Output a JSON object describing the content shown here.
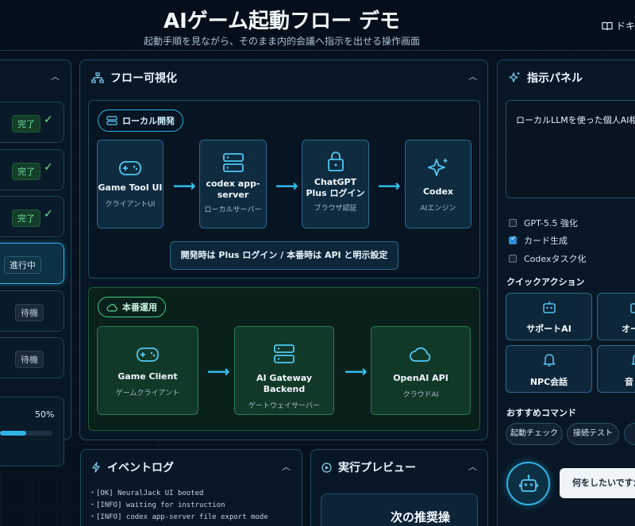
{
  "header": {
    "title": "AIゲーム起動フロー デモ",
    "subtitle": "起動手順を見ながら、そのまま内的会議へ指示を出せる操作画面",
    "doc_link": "ドキュ"
  },
  "steps": {
    "items": [
      {
        "status": "完了",
        "state": "done"
      },
      {
        "status": "完了",
        "state": "done"
      },
      {
        "status": "完了",
        "state": "done"
      },
      {
        "status": "進行中",
        "state": "active"
      },
      {
        "status": "待機",
        "state": "waiting"
      },
      {
        "status": "待機",
        "state": "waiting"
      }
    ],
    "progress_text": "50%",
    "progress_value": 0.5
  },
  "flow": {
    "title": "フロー可視化",
    "local": {
      "label": "ローカル開発",
      "nodes": [
        {
          "title": "Game Tool UI",
          "sub": "クライアントUI",
          "icon": "gamepad-icon"
        },
        {
          "title": "codex app-server",
          "sub": "ローカルサーバー",
          "icon": "server-icon"
        },
        {
          "title": "ChatGPT Plus ログイン",
          "sub": "ブラウザ認証",
          "icon": "lock-icon"
        },
        {
          "title": "Codex",
          "sub": "AIエンジン",
          "icon": "sparkle-icon"
        }
      ],
      "note": "開発時は Plus ログイン / 本番時は API と明示設定"
    },
    "production": {
      "label": "本番運用",
      "nodes": [
        {
          "title": "Game Client",
          "sub": "ゲームクライアント",
          "icon": "gamepad-icon"
        },
        {
          "title": "AI Gateway Backend",
          "sub": "ゲートウェイサーバー",
          "icon": "server-icon"
        },
        {
          "title": "OpenAI API",
          "sub": "クラウドAI",
          "icon": "cloud-icon"
        }
      ]
    }
  },
  "event_log": {
    "title": "イベントログ",
    "lines": [
      "・[OK] NeuralJack UI booted",
      "・[INFO] waiting for instruction",
      "・[INFO] codex app-server file export mode"
    ]
  },
  "preview": {
    "title": "実行プレビュー",
    "heading": "次の推奨操"
  },
  "instructions": {
    "title": "指示パネル",
    "textarea_value": "ローカルLLMを使った個人AI相棒",
    "options": [
      {
        "label": "GPT-5.5 強化",
        "checked": false
      },
      {
        "label": "カード生成",
        "checked": true
      },
      {
        "label": "Codexタスク化",
        "checked": false
      }
    ],
    "quick_actions_title": "クイックアクション",
    "quick_actions": [
      {
        "label": "サポートAI",
        "icon": "robot-icon"
      },
      {
        "label": "オー",
        "icon": "robot-icon"
      },
      {
        "label": "NPC会話",
        "icon": "bell-icon"
      },
      {
        "label": "音",
        "icon": "bell-icon"
      }
    ],
    "commands_title": "おすすめコマンド",
    "commands": [
      "起動チェック",
      "接続テスト",
      "l"
    ],
    "chat_prompt": "何をしたいですか"
  }
}
